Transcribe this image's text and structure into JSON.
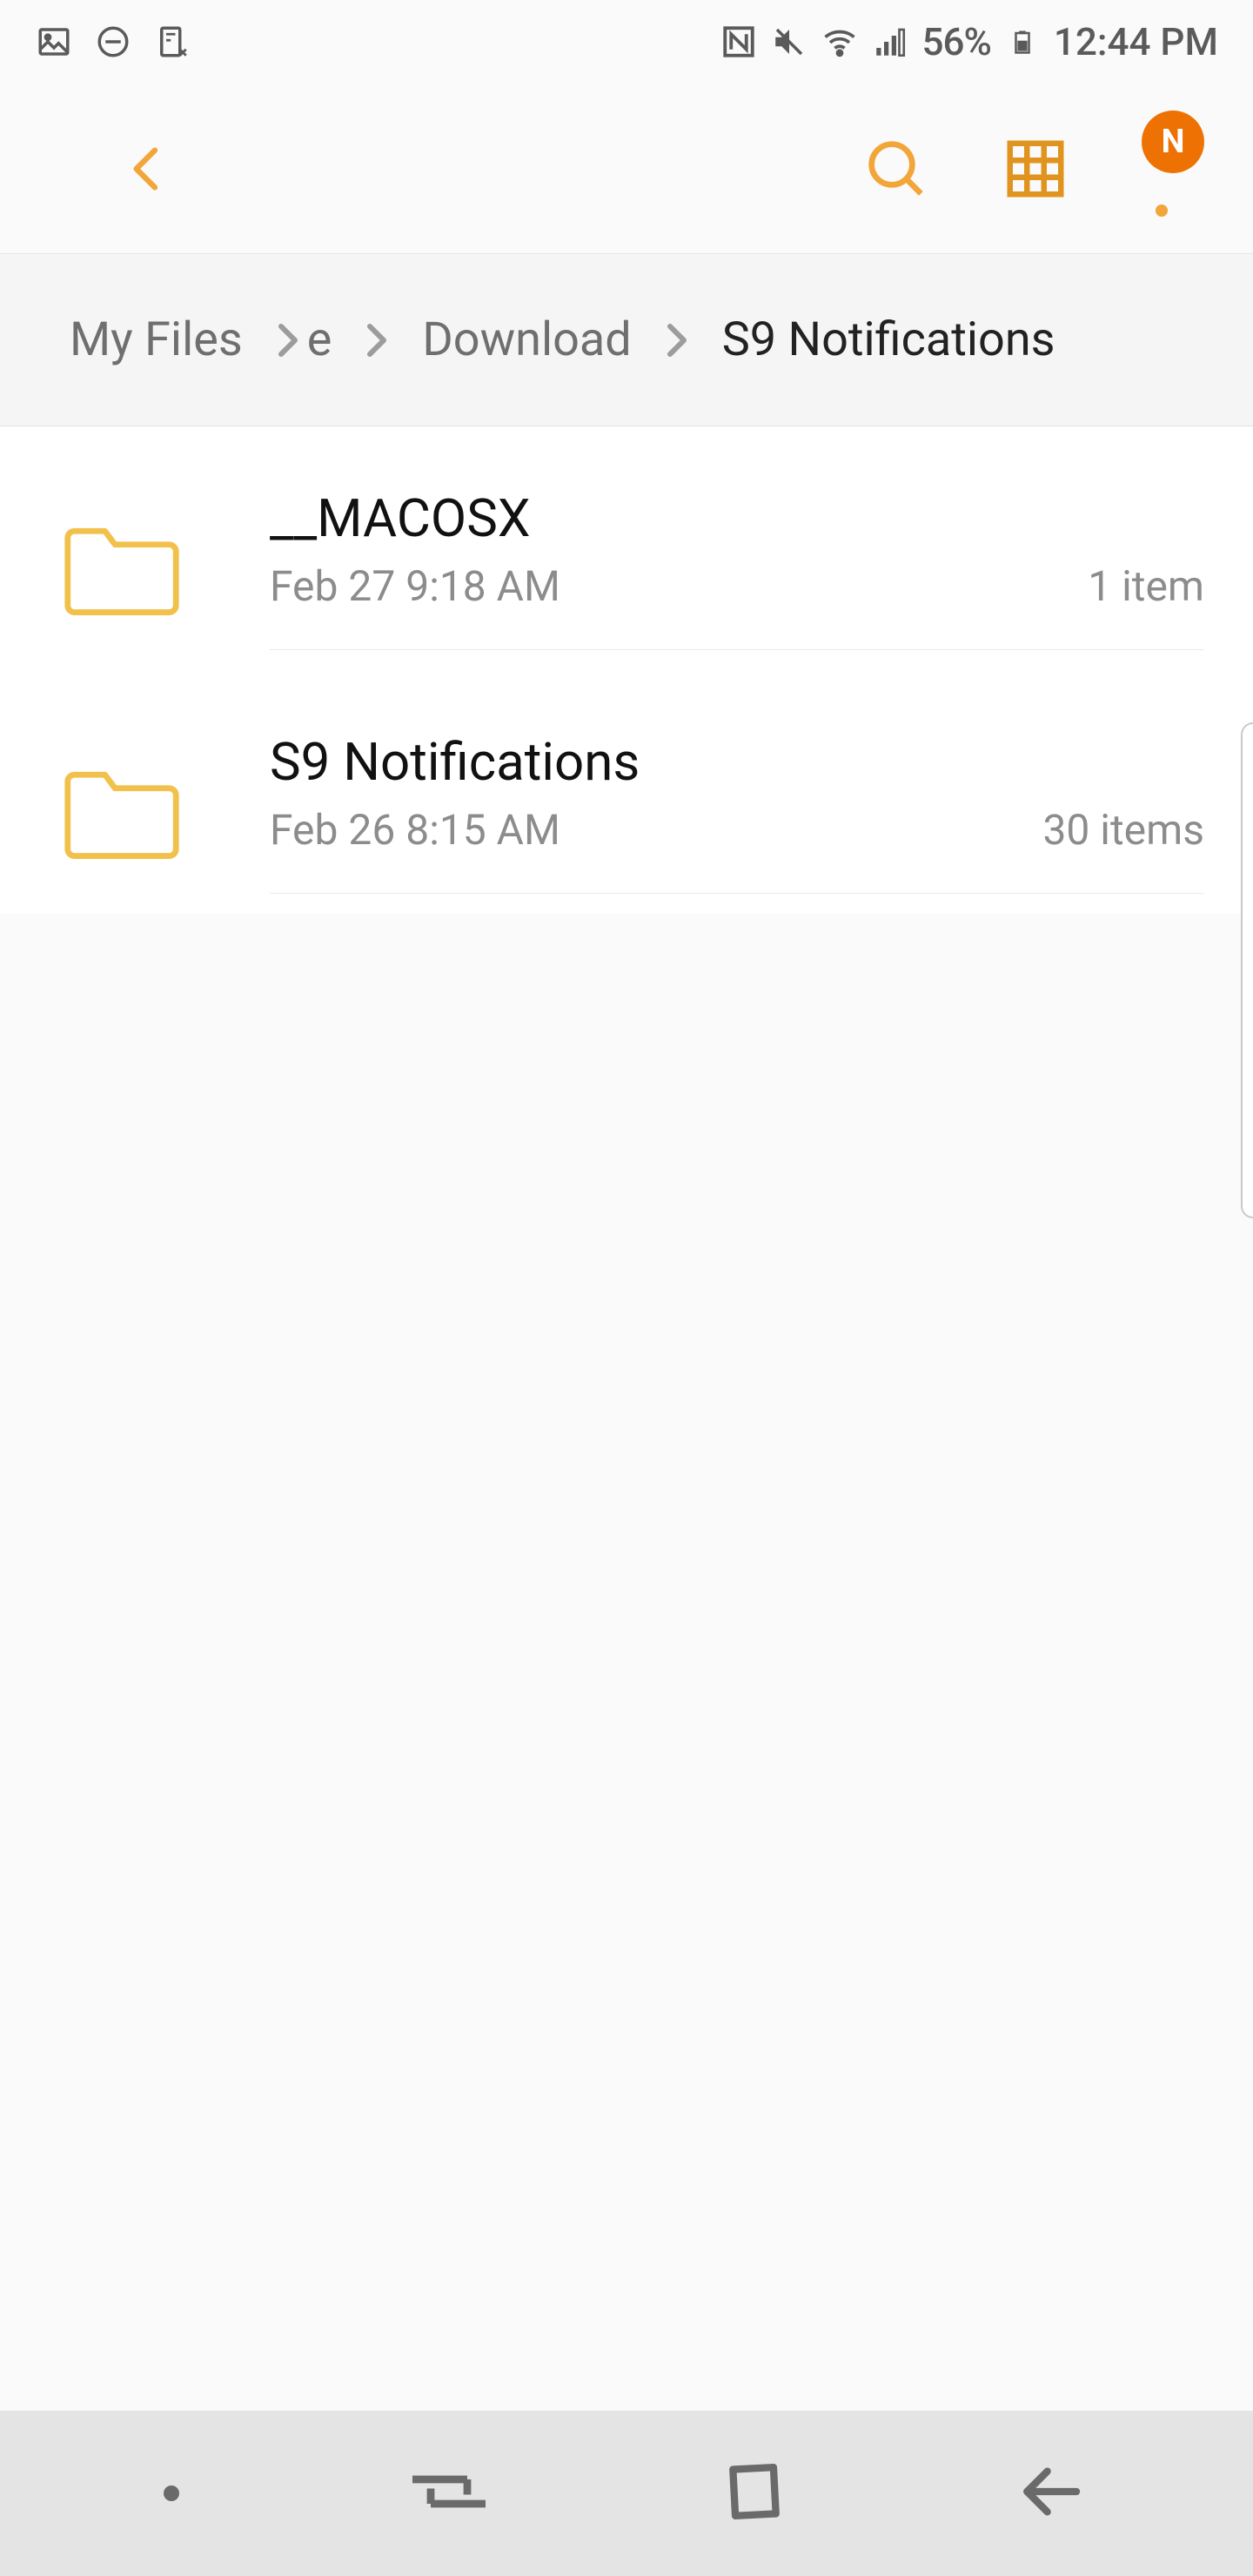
{
  "status": {
    "battery_text": "56%",
    "time": "12:44 PM"
  },
  "overflow": {
    "badge_letter": "N"
  },
  "breadcrumb": {
    "root": "My Files",
    "fragment": "e",
    "mid": "Download",
    "current": "S9 Notifications"
  },
  "files": [
    {
      "name": "__MACOSX",
      "date": "Feb 27 9:18 AM",
      "count": "1 item"
    },
    {
      "name": "S9 Notifications",
      "date": "Feb 26 8:15 AM",
      "count": "30 items"
    }
  ]
}
